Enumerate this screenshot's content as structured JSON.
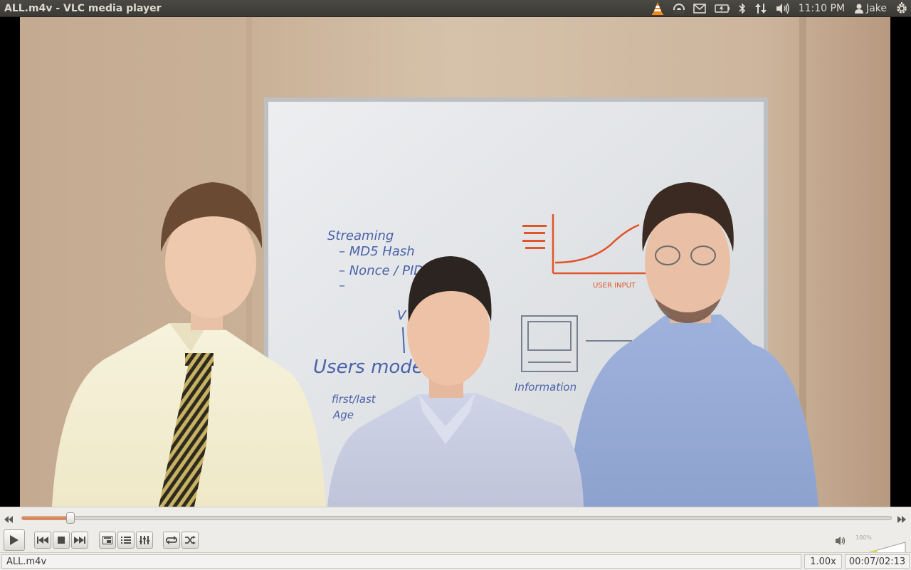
{
  "window": {
    "title": "ALL.m4v - VLC media player"
  },
  "panel": {
    "indicators": [
      "vlc-cone-icon",
      "wifi-icon",
      "mail-icon",
      "battery-icon",
      "bluetooth-icon",
      "network-transfer-icon",
      "volume-icon"
    ],
    "clock": "11:10 PM",
    "user": "Jake",
    "session_icon": "gear-icon"
  },
  "video": {
    "whiteboard_text": {
      "heading": "Streaming",
      "item1": "– MD5 Hash",
      "item2": "– Nonce / PID",
      "item3": "–",
      "model": "Users model",
      "fields1": "first/last",
      "fields2": "Age",
      "vc": "V",
      "device_label": "Information",
      "graph_xlabel": "USER INPUT"
    }
  },
  "playback": {
    "progress": 0.0547,
    "elapsed": "00:07",
    "total": "02:13",
    "time_display": "00:07/02:13",
    "rate": "1.00x",
    "file_name": "ALL.m4v"
  },
  "volume": {
    "level_percent": 100,
    "label": "100%"
  },
  "colors": {
    "seek_fill": "#e2692c",
    "panel_bg": "#3c3b37",
    "controls_bg": "#edece9"
  },
  "buttons": [
    "play",
    "previous",
    "stop",
    "next",
    "fullscreen",
    "playlist",
    "extended-settings",
    "loop",
    "random"
  ]
}
